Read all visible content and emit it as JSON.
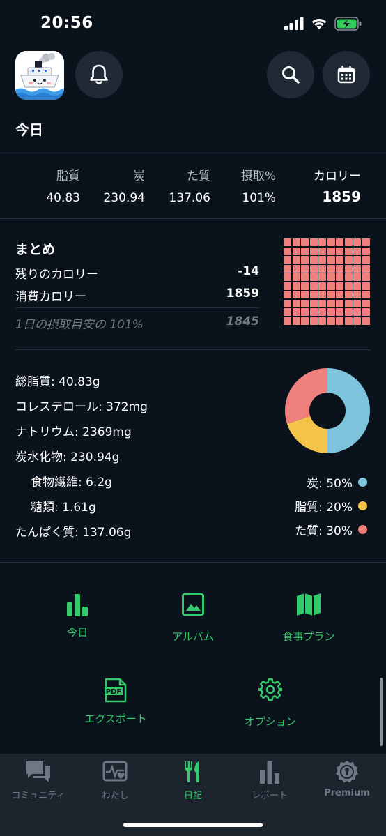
{
  "status_bar": {
    "time": "20:56"
  },
  "header": {
    "title": "今日"
  },
  "macros": [
    {
      "label": "脂質",
      "value": "40.83"
    },
    {
      "label": "炭",
      "value": "230.94"
    },
    {
      "label": "た質",
      "value": "137.06"
    },
    {
      "label": "摂取%",
      "value": "101%"
    },
    {
      "label": "カロリー",
      "value": "1859"
    }
  ],
  "summary": {
    "title": "まとめ",
    "remaining_label": "残りのカロリー",
    "remaining_value": "-14",
    "consumed_label": "消費カロリー",
    "consumed_value": "1859",
    "target_label": "1日の摂取目安の 101%",
    "target_value": "1845",
    "grid_filled_fraction": 1.0
  },
  "nutrients": {
    "fat": "総脂質: 40.83g",
    "cholesterol": "コレステロール: 372mg",
    "sodium": "ナトリウム: 2369mg",
    "carbs": "炭水化物: 230.94g",
    "fiber": "食物繊維: 6.2g",
    "sugar": "糖類: 1.61g",
    "protein": "たんぱく質: 137.06g"
  },
  "chart_data": {
    "type": "pie",
    "categories": [
      "炭",
      "脂質",
      "た質"
    ],
    "values": [
      50,
      20,
      30
    ],
    "colors": [
      "#7ec4dd",
      "#f5c54b",
      "#f0807d"
    ],
    "legend": [
      "炭: 50%",
      "脂質: 20%",
      "た質: 30%"
    ]
  },
  "menu": {
    "today": "今日",
    "album": "アルバム",
    "meal_plan": "食事プラン",
    "export": "エクスポート",
    "options": "オプション",
    "export_badge": "PDF"
  },
  "tabs": [
    {
      "label": "コミュニティ",
      "icon": "chat-icon"
    },
    {
      "label": "わたし",
      "icon": "heart-monitor-icon"
    },
    {
      "label": "日記",
      "icon": "fork-knife-icon"
    },
    {
      "label": "レポート",
      "icon": "bar-chart-icon"
    },
    {
      "label": "Premium",
      "icon": "premium-badge-icon"
    }
  ],
  "colors": {
    "accent": "#34c96b",
    "background": "#0a121c",
    "grid_red": "#f0807d"
  }
}
